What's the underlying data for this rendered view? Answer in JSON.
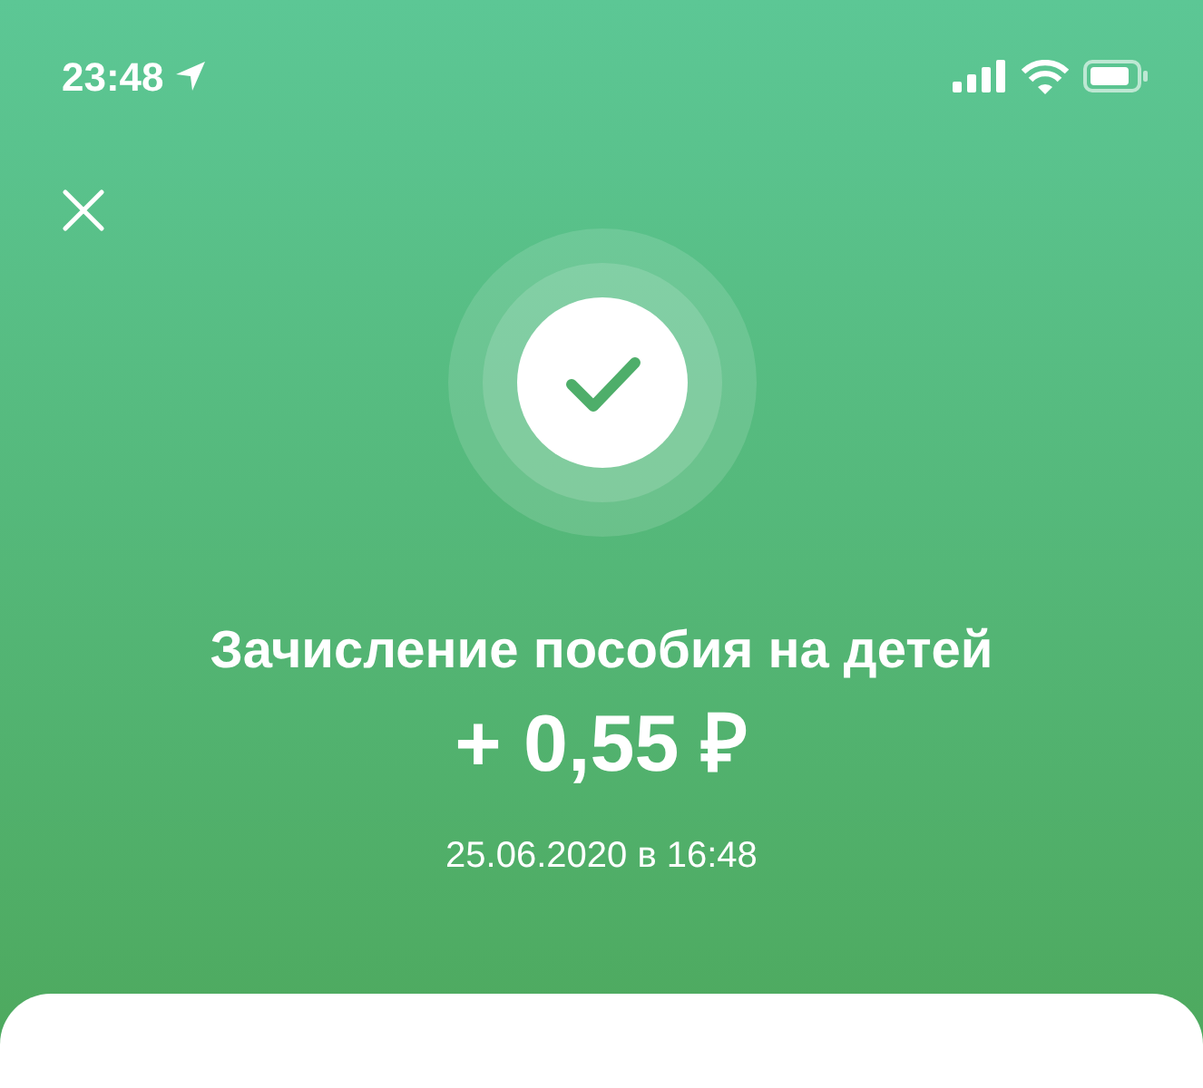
{
  "status_bar": {
    "time": "23:48"
  },
  "title": "Зачисление пособия на детей",
  "amount": "+ 0,55 ₽",
  "date": "25.06.2020 в 16:48"
}
